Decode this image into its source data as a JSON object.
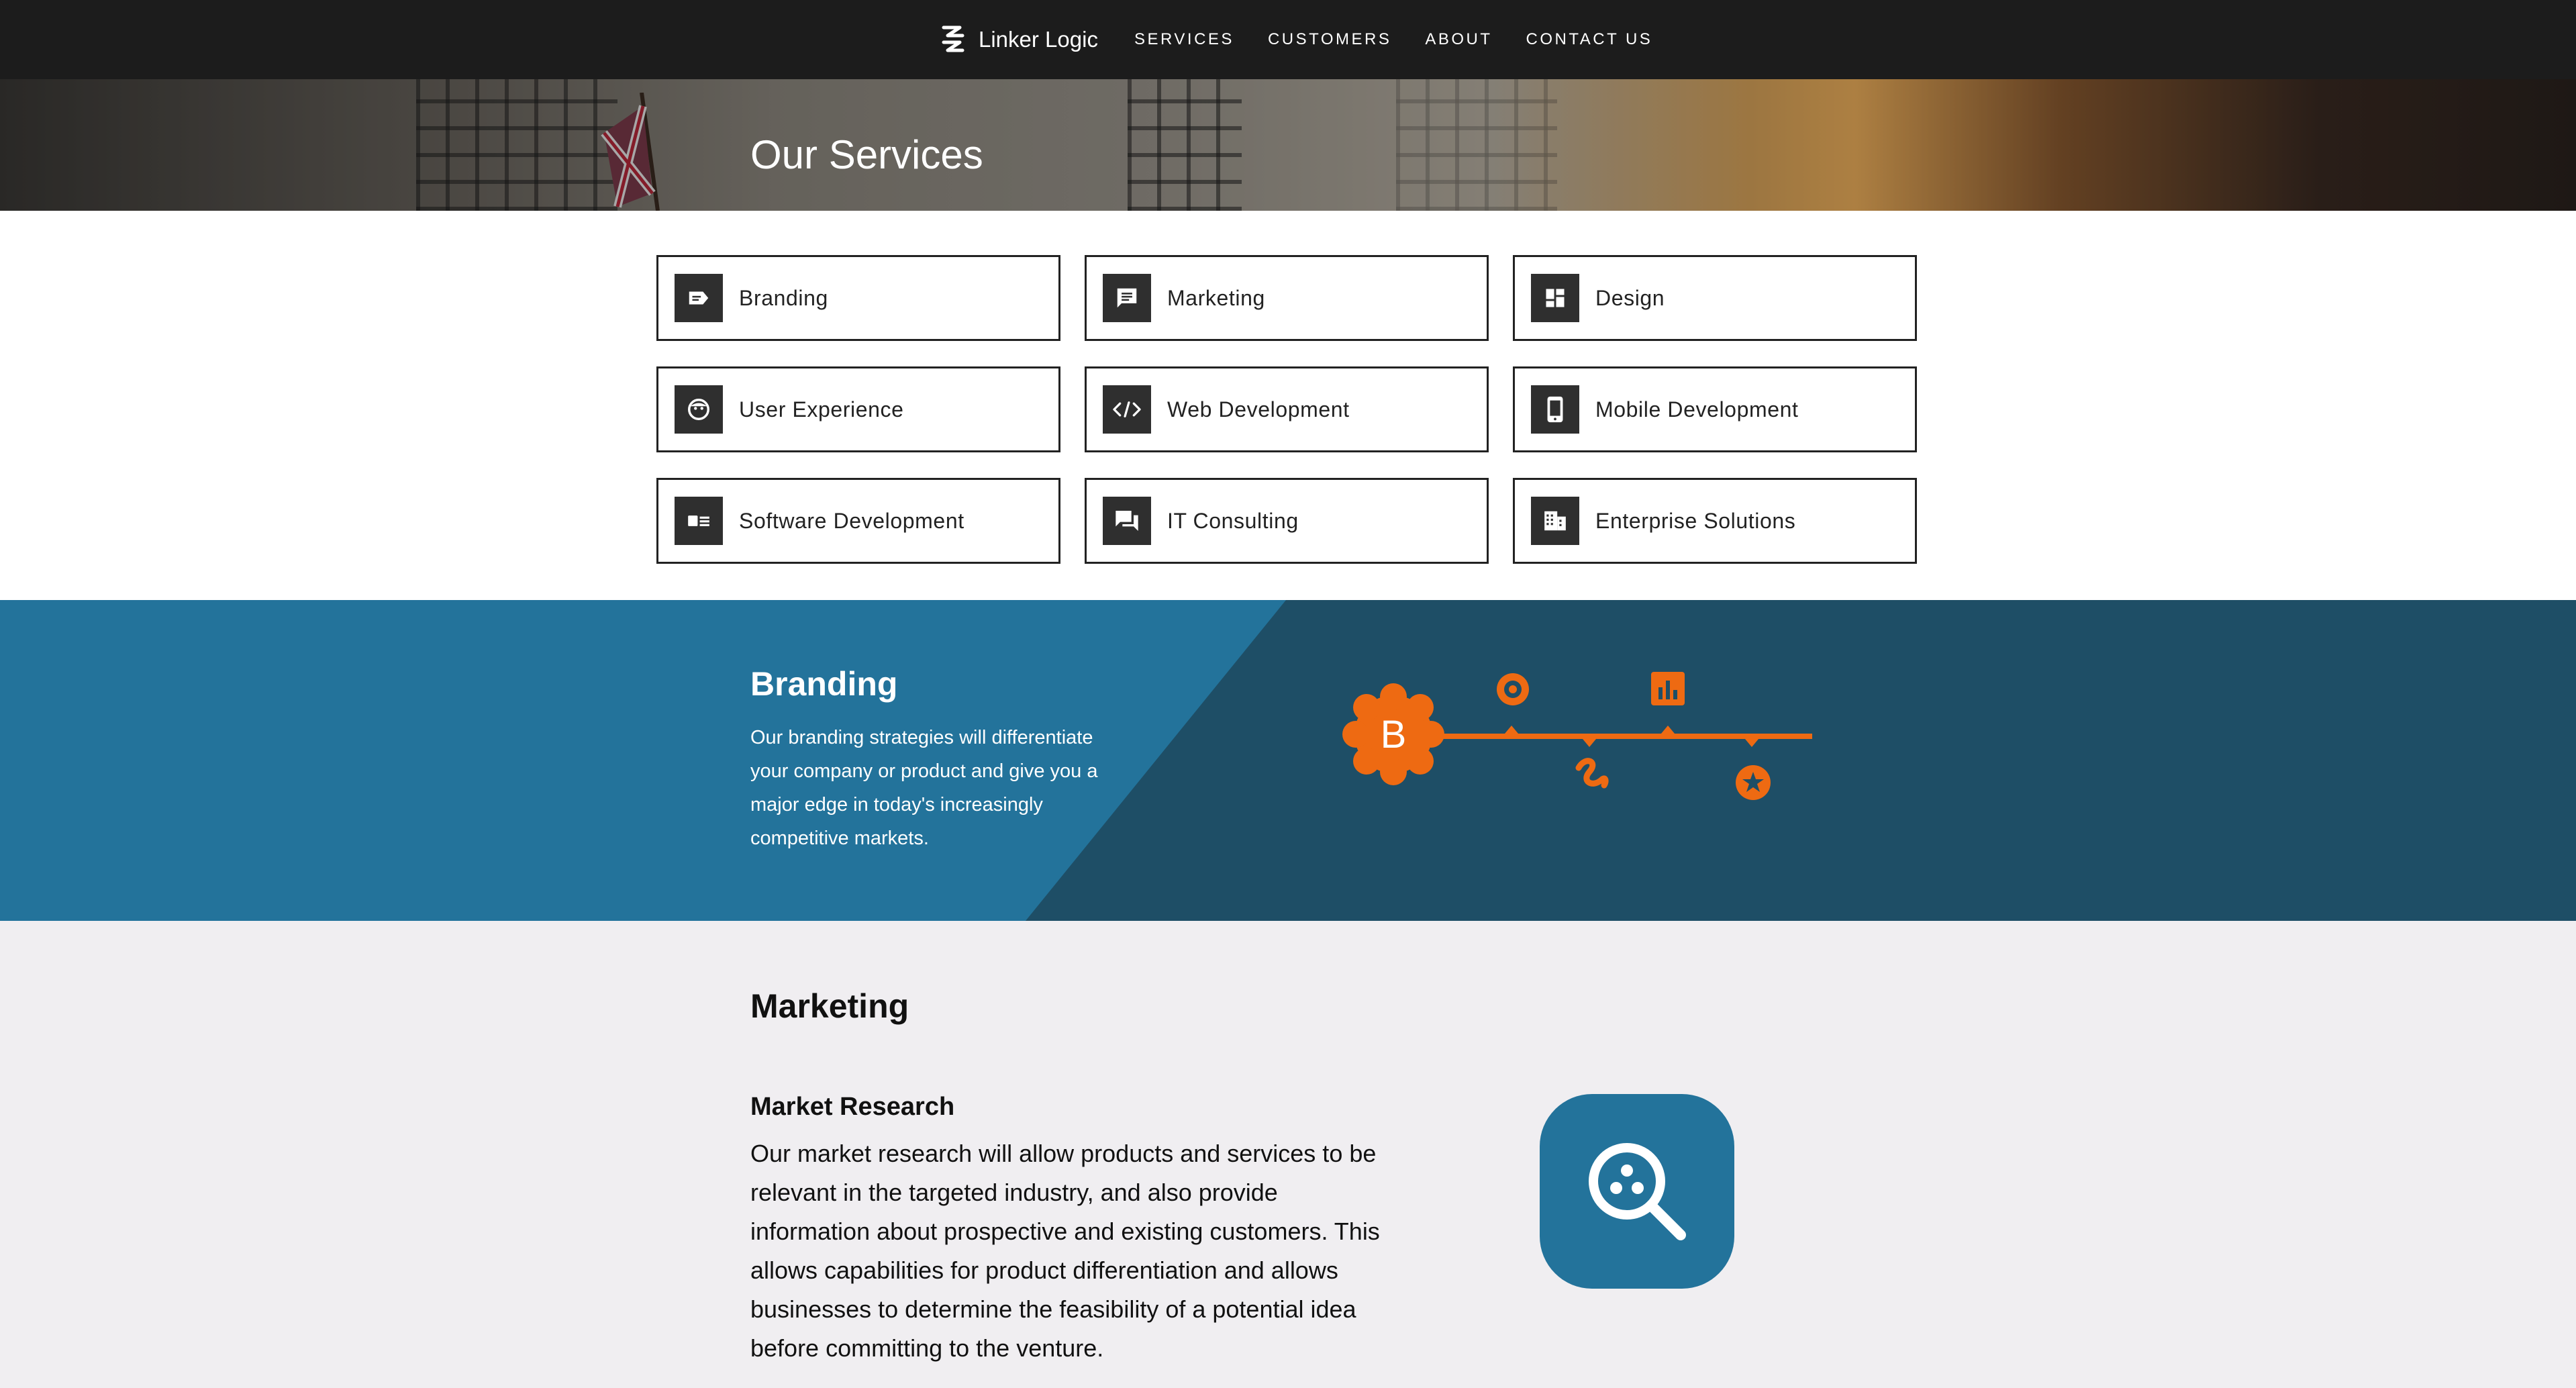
{
  "nav": {
    "brand": "Linker Logic",
    "brand_icon": "linker-logic-logo",
    "links": [
      "SERVICES",
      "CUSTOMERS",
      "ABOUT",
      "CONTACT US"
    ]
  },
  "hero": {
    "title": "Our Services"
  },
  "services": [
    {
      "label": "Branding",
      "icon": "label-icon"
    },
    {
      "label": "Marketing",
      "icon": "chat-icon"
    },
    {
      "label": "Design",
      "icon": "dashboard-icon"
    },
    {
      "label": "User Experience",
      "icon": "face-icon"
    },
    {
      "label": "Web Development",
      "icon": "code-icon"
    },
    {
      "label": "Mobile Development",
      "icon": "smartphone-icon"
    },
    {
      "label": "Software Development",
      "icon": "software-icon"
    },
    {
      "label": "IT Consulting",
      "icon": "forum-icon"
    },
    {
      "label": "Enterprise Solutions",
      "icon": "building-icon"
    }
  ],
  "branding": {
    "title": "Branding",
    "description": "Our branding strategies will differentiate your company or product and give you a major edge in today's increasingly competitive markets.",
    "badge_letter": "B"
  },
  "marketing": {
    "title": "Marketing",
    "subsection_title": "Market Research",
    "subsection_text": "Our market research will allow products and services to be relevant in the targeted industry, and also provide information about prospective and existing customers. This allows capabilities for product differentiation and allows businesses to determine the feasibility of a potential idea before committing to the venture.",
    "icon": "search-icon"
  },
  "colors": {
    "nav_bg": "#1c1c1c",
    "branding_light": "#23739b",
    "branding_dark": "#1e4e66",
    "accent_orange": "#ee6a12",
    "marketing_bg": "#f0eef1"
  }
}
